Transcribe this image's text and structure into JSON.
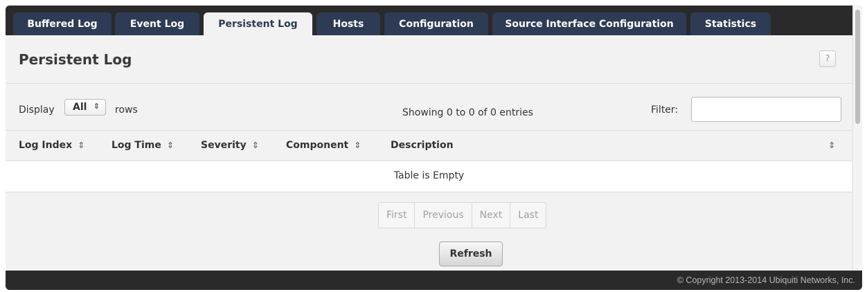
{
  "tabs": [
    {
      "label": "Buffered Log",
      "active": false
    },
    {
      "label": "Event Log",
      "active": false
    },
    {
      "label": "Persistent Log",
      "active": true
    },
    {
      "label": "Hosts",
      "active": false
    },
    {
      "label": "Configuration",
      "active": false
    },
    {
      "label": "Source Interface Configuration",
      "active": false
    },
    {
      "label": "Statistics",
      "active": false
    }
  ],
  "page": {
    "title": "Persistent Log",
    "help_label": "?"
  },
  "controls": {
    "display_label": "Display",
    "rows_select_value": "All",
    "rows_label": "rows",
    "showing_text": "Showing 0 to 0 of 0 entries",
    "filter_label": "Filter:",
    "filter_value": ""
  },
  "table": {
    "columns": [
      "Log Index",
      "Log Time",
      "Severity",
      "Component",
      "Description"
    ],
    "sort_icon": "sort-both-icon",
    "empty_text": "Table is Empty"
  },
  "pagination": [
    "First",
    "Previous",
    "Next",
    "Last"
  ],
  "refresh_label": "Refresh",
  "footer": {
    "copyright": "© Copyright 2013-2014 Ubiquiti Networks, Inc."
  },
  "colors": {
    "tab_bg": "#2e3b55",
    "tab_active_bg": "#f2f2f2",
    "chrome": "#2a2a2a"
  }
}
